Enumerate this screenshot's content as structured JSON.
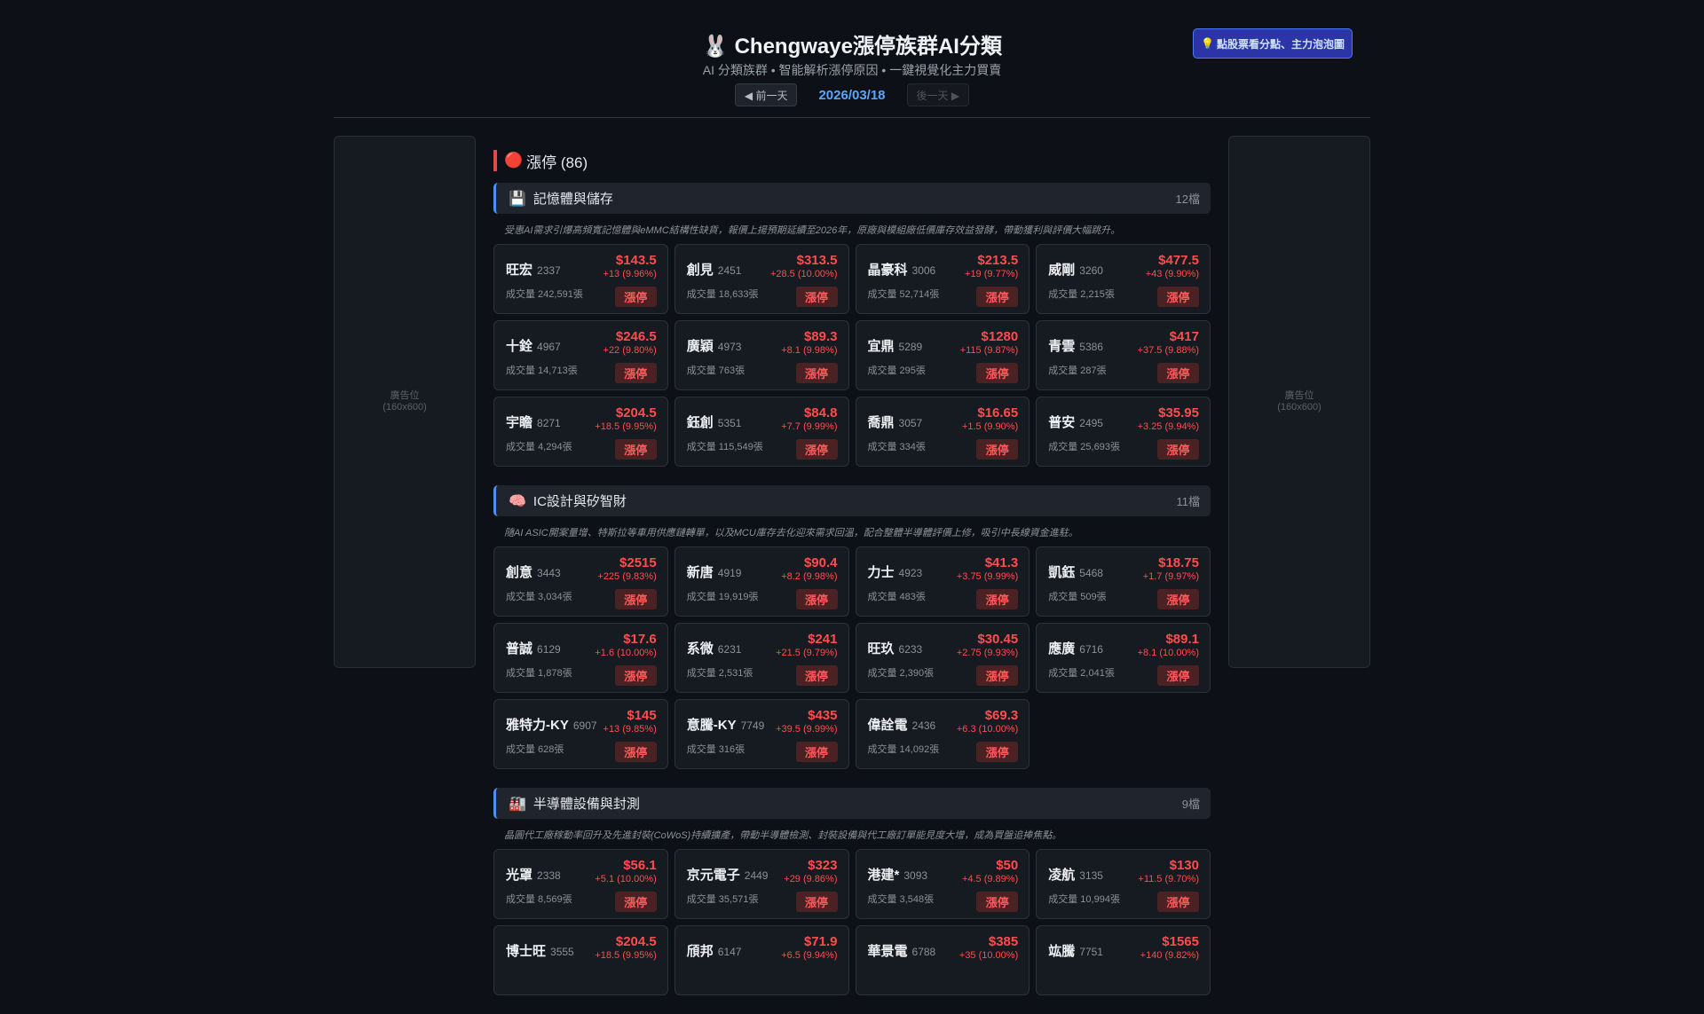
{
  "header": {
    "logo_emoji": "🐰",
    "title": "Chengwaye漲停族群AI分類",
    "subtitle": "AI 分類族群 • 智能解析漲停原因 • 一鍵視覺化主力買賣",
    "prev_label": "◀ 前一天",
    "date": "2026/03/18",
    "next_label": "後一天 ▶",
    "tip_icon": "💡",
    "tip_label": "點股票看分點、主力泡泡圖"
  },
  "ads": {
    "left_label": "廣告位",
    "left_size": "(160x600)",
    "right_label": "廣告位",
    "right_size": "(160x600)"
  },
  "main": {
    "section_icon": "🔴",
    "section_title": "漲停 (86)",
    "badge_label": "漲停",
    "volume_prefix": "成交量 ",
    "categories": [
      {
        "icon": "💾",
        "name": "記憶體與儲存",
        "count": "12檔",
        "desc": "受惠AI需求引爆高頻寬記憶體與eMMC結構性缺貨，報價上揚預期延續至2026年，原廠與模組廠低價庫存效益發酵，帶動獲利與評價大幅跳升。",
        "stocks": [
          {
            "name": "旺宏",
            "code": "2337",
            "price": "$143.5",
            "change": "+13 (9.96%)",
            "volume": "242,591張"
          },
          {
            "name": "創見",
            "code": "2451",
            "price": "$313.5",
            "change": "+28.5 (10.00%)",
            "volume": "18,633張"
          },
          {
            "name": "晶豪科",
            "code": "3006",
            "price": "$213.5",
            "change": "+19 (9.77%)",
            "volume": "52,714張"
          },
          {
            "name": "威剛",
            "code": "3260",
            "price": "$477.5",
            "change": "+43 (9.90%)",
            "volume": "2,215張"
          },
          {
            "name": "十銓",
            "code": "4967",
            "price": "$246.5",
            "change": "+22 (9.80%)",
            "volume": "14,713張"
          },
          {
            "name": "廣穎",
            "code": "4973",
            "price": "$89.3",
            "change": "+8.1 (9.98%)",
            "volume": "763張"
          },
          {
            "name": "宜鼎",
            "code": "5289",
            "price": "$1280",
            "change": "+115 (9.87%)",
            "volume": "295張"
          },
          {
            "name": "青雲",
            "code": "5386",
            "price": "$417",
            "change": "+37.5 (9.88%)",
            "volume": "287張"
          },
          {
            "name": "宇瞻",
            "code": "8271",
            "price": "$204.5",
            "change": "+18.5 (9.95%)",
            "volume": "4,294張"
          },
          {
            "name": "鈺創",
            "code": "5351",
            "price": "$84.8",
            "change": "+7.7 (9.99%)",
            "volume": "115,549張"
          },
          {
            "name": "喬鼎",
            "code": "3057",
            "price": "$16.65",
            "change": "+1.5 (9.90%)",
            "volume": "334張"
          },
          {
            "name": "普安",
            "code": "2495",
            "price": "$35.95",
            "change": "+3.25 (9.94%)",
            "volume": "25,693張"
          }
        ]
      },
      {
        "icon": "🧠",
        "name": "IC設計與矽智財",
        "count": "11檔",
        "desc": "隨AI ASIC開案量增、特斯拉等車用供應鏈轉單，以及MCU庫存去化迎來需求回溫，配合整體半導體評價上修，吸引中長線資金進駐。",
        "stocks": [
          {
            "name": "創意",
            "code": "3443",
            "price": "$2515",
            "change": "+225 (9.83%)",
            "volume": "3,034張"
          },
          {
            "name": "新唐",
            "code": "4919",
            "price": "$90.4",
            "change": "+8.2 (9.98%)",
            "volume": "19,919張"
          },
          {
            "name": "力士",
            "code": "4923",
            "price": "$41.3",
            "change": "+3.75 (9.99%)",
            "volume": "483張"
          },
          {
            "name": "凱鈺",
            "code": "5468",
            "price": "$18.75",
            "change": "+1.7 (9.97%)",
            "volume": "509張"
          },
          {
            "name": "普誠",
            "code": "6129",
            "price": "$17.6",
            "change": "+1.6 (10.00%)",
            "volume": "1,878張"
          },
          {
            "name": "系微",
            "code": "6231",
            "price": "$241",
            "change": "+21.5 (9.79%)",
            "volume": "2,531張"
          },
          {
            "name": "旺玖",
            "code": "6233",
            "price": "$30.45",
            "change": "+2.75 (9.93%)",
            "volume": "2,390張"
          },
          {
            "name": "應廣",
            "code": "6716",
            "price": "$89.1",
            "change": "+8.1 (10.00%)",
            "volume": "2,041張"
          },
          {
            "name": "雅特力-KY",
            "code": "6907",
            "price": "$145",
            "change": "+13 (9.85%)",
            "volume": "628張"
          },
          {
            "name": "意騰-KY",
            "code": "7749",
            "price": "$435",
            "change": "+39.5 (9.99%)",
            "volume": "316張"
          },
          {
            "name": "偉詮電",
            "code": "2436",
            "price": "$69.3",
            "change": "+6.3 (10.00%)",
            "volume": "14,092張"
          }
        ]
      },
      {
        "icon": "🏭",
        "name": "半導體設備與封測",
        "count": "9檔",
        "desc": "晶圓代工廠稼動率回升及先進封裝(CoWoS)持續擴產，帶動半導體檢測、封裝設備與代工廠訂單能見度大增，成為買盤追捧焦點。",
        "stocks": [
          {
            "name": "光罩",
            "code": "2338",
            "price": "$56.1",
            "change": "+5.1 (10.00%)",
            "volume": "8,569張"
          },
          {
            "name": "京元電子",
            "code": "2449",
            "price": "$323",
            "change": "+29 (9.86%)",
            "volume": "35,571張"
          },
          {
            "name": "港建*",
            "code": "3093",
            "price": "$50",
            "change": "+4.5 (9.89%)",
            "volume": "3,548張"
          },
          {
            "name": "凌航",
            "code": "3135",
            "price": "$130",
            "change": "+11.5 (9.70%)",
            "volume": "10,994張"
          },
          {
            "name": "博士旺",
            "code": "3555",
            "price": "$204.5",
            "change": "+18.5 (9.95%)"
          },
          {
            "name": "頎邦",
            "code": "6147",
            "price": "$71.9",
            "change": "+6.5 (9.94%)"
          },
          {
            "name": "華景電",
            "code": "6788",
            "price": "$385",
            "change": "+35 (10.00%)"
          },
          {
            "name": "竑騰",
            "code": "7751",
            "price": "$1565",
            "change": "+140 (9.82%)"
          }
        ]
      }
    ]
  }
}
